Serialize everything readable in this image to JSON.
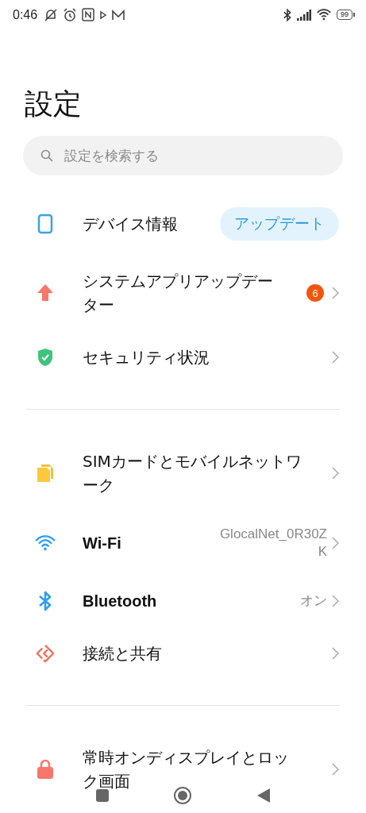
{
  "status_bar": {
    "time": "0:46",
    "battery": "99"
  },
  "title": "設定",
  "search": {
    "placeholder": "設定を検索する"
  },
  "sections": [
    {
      "items": [
        {
          "kind": "device",
          "label": "デバイス情報",
          "action": "アップデート"
        },
        {
          "kind": "update",
          "label": "システムアプリアップデーター",
          "badge": "6"
        },
        {
          "kind": "security",
          "label": "セキュリティ状況"
        }
      ]
    },
    {
      "items": [
        {
          "kind": "sim",
          "label": "SIMカードとモバイルネットワーク"
        },
        {
          "kind": "wifi",
          "label": "Wi-Fi",
          "value": "GlocalNet_0R30ZK"
        },
        {
          "kind": "bluetooth",
          "label": "Bluetooth",
          "value": "オン"
        },
        {
          "kind": "share",
          "label": "接続と共有"
        }
      ]
    },
    {
      "items": [
        {
          "kind": "lock",
          "label": "常時オンディスプレイとロック画面"
        }
      ]
    }
  ]
}
